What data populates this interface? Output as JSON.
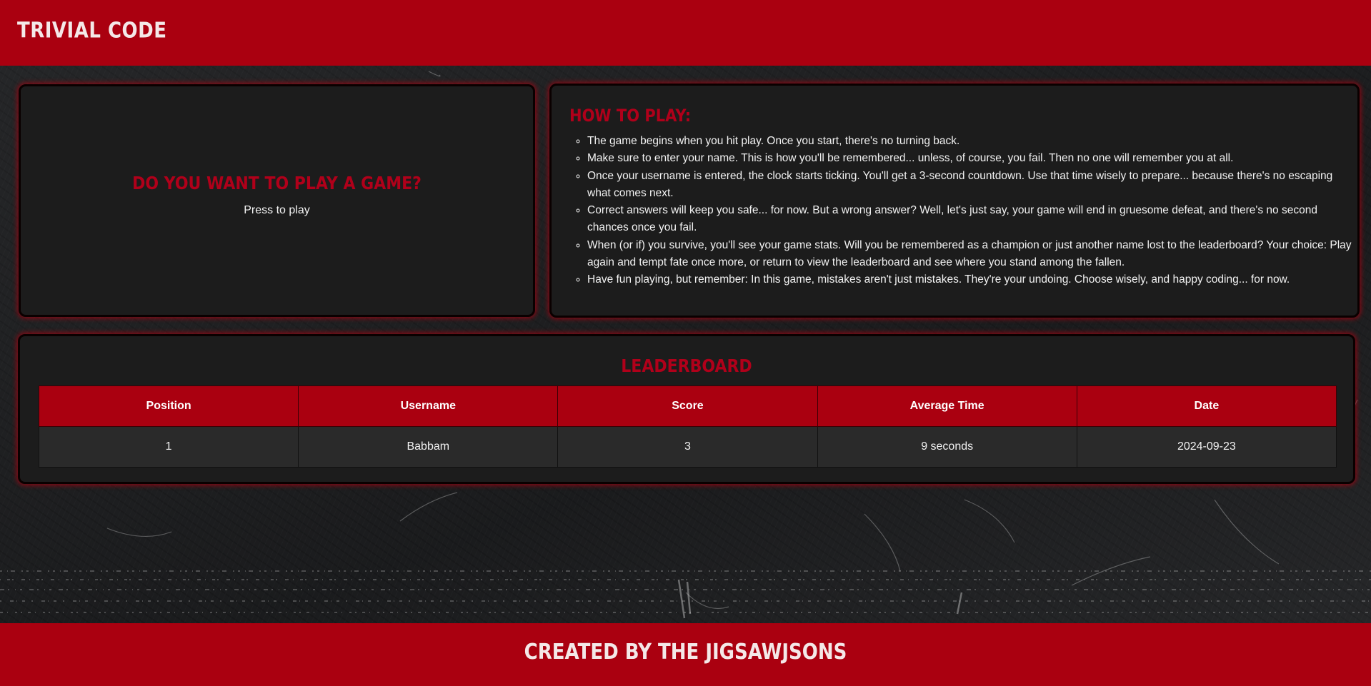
{
  "header": {
    "title": "Trivial Code"
  },
  "play": {
    "heading": "Do you want to play a game?",
    "button_label": "Press to play"
  },
  "how_to_play": {
    "heading": "How to play:",
    "rules": [
      "The game begins when you hit play. Once you start, there's no turning back.",
      "Make sure to enter your name. This is how you'll be remembered... unless, of course, you fail. Then no one will remember you at all.",
      "Once your username is entered, the clock starts ticking. You'll get a 3-second countdown. Use that time wisely to prepare... because there's no escaping what comes next.",
      "Correct answers will keep you safe... for now. But a wrong answer? Well, let's just say, your game will end in gruesome defeat, and there's no second chances once you fail.",
      "When (or if) you survive, you'll see your game stats. Will you be remembered as a champion or just another name lost to the leaderboard? Your choice: Play again and tempt fate once more, or return to view the leaderboard and see where you stand among the fallen.",
      "Have fun playing, but remember: In this game, mistakes aren't just mistakes. They're your undoing. Choose wisely, and happy coding... for now."
    ]
  },
  "leaderboard": {
    "heading": "Leaderboard",
    "columns": [
      "Position",
      "Username",
      "Score",
      "Average Time",
      "Date"
    ],
    "rows": [
      [
        "1",
        "Babbam",
        "3",
        "9 seconds",
        "2024-09-23"
      ]
    ]
  },
  "footer": {
    "text": "Created by the JigsawJSONs"
  },
  "colors": {
    "brand_red": "#aa0010",
    "heading_red": "#b0001a",
    "card_bg": "#1c1c1c",
    "page_bg": "#1f2022"
  }
}
